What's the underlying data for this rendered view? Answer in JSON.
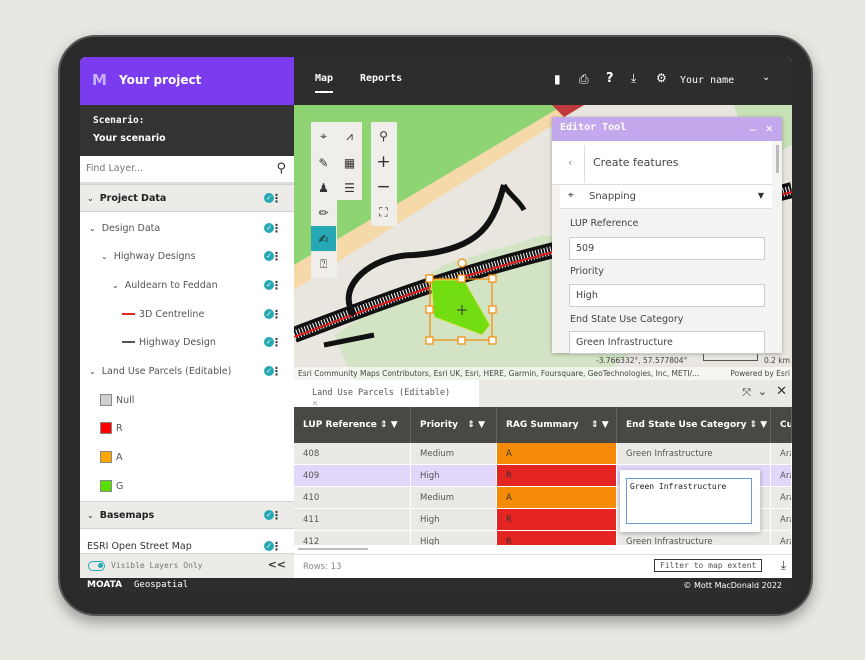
{
  "colors": {
    "brand": "#7b3cf0",
    "accent": "#26a9b5",
    "red": "#e52521",
    "amber": "#f58a07",
    "green": "#5edb00",
    "editor_header": "#c4a8ee"
  },
  "sidebar": {
    "logo": "M",
    "project": "Your project",
    "scenario_label": "Scenario:",
    "scenario": "Your scenario",
    "find_placeholder": "Find Layer...",
    "items": [
      {
        "label": "Project Data"
      },
      {
        "label": "Design Data"
      },
      {
        "label": "Highway Designs"
      },
      {
        "label": "Auldearn to Feddan"
      },
      {
        "label": "3D Centreline"
      },
      {
        "label": "Highway Design"
      },
      {
        "label": "Land Use Parcels (Editable)"
      },
      {
        "label": "Basemaps"
      },
      {
        "label": "ESRI Open Street Map"
      }
    ],
    "legend": [
      {
        "label": "Null",
        "color": "#d0d0d0"
      },
      {
        "label": "R",
        "color": "#ff0000"
      },
      {
        "label": "A",
        "color": "#ffa500"
      },
      {
        "label": "G",
        "color": "#55e000"
      }
    ],
    "visible_only": "Visible Layers Only",
    "collapse": "<<"
  },
  "topbar": {
    "tabs": [
      "Map",
      "Reports"
    ],
    "active_tab": "Map",
    "user": "Your name",
    "icons": [
      "bookmark-icon",
      "print-icon",
      "help-icon",
      "download-icon",
      "settings-icon"
    ]
  },
  "editor": {
    "title": "Editor Tool",
    "subtitle": "Create features",
    "snapping": "Snapping",
    "fields": [
      {
        "label": "LUP Reference",
        "value": "509"
      },
      {
        "label": "Priority",
        "value": "High"
      },
      {
        "label": "End State Use Category",
        "value": "Green Infrastructure"
      }
    ]
  },
  "map": {
    "coords": "-3.766332°, 57.577804°",
    "scale": "0.2 km",
    "attribution": "Esri Community Maps Contributors, Esri UK, Esri, HERE, Garmin, Foursquare, GeoTechnologies, Inc, METI/...",
    "powered": "Powered by Esri"
  },
  "table": {
    "tab": "Land Use Parcels (Editable)",
    "columns": [
      "LUP Reference",
      "Priority",
      "RAG Summary",
      "End State Use Category",
      "Cu"
    ],
    "rows": [
      [
        "408",
        "Medium",
        "A",
        "Green Infrastructure",
        "Ara"
      ],
      [
        "409",
        "High",
        "R",
        "",
        "Ara"
      ],
      [
        "410",
        "Medium",
        "A",
        "",
        "Ara"
      ],
      [
        "411",
        "High",
        "R",
        "",
        "Ara"
      ],
      [
        "412",
        "High",
        "R",
        "Green Infrastructure",
        "Ara"
      ]
    ],
    "editing_value": "Green Infrastructure",
    "rows_count": "Rows: 13",
    "filter_button": "Filter to map extent"
  },
  "footer": {
    "brand": "MOATA",
    "product": "Geospatial",
    "copyright": "© Mott MacDonald 2022"
  }
}
